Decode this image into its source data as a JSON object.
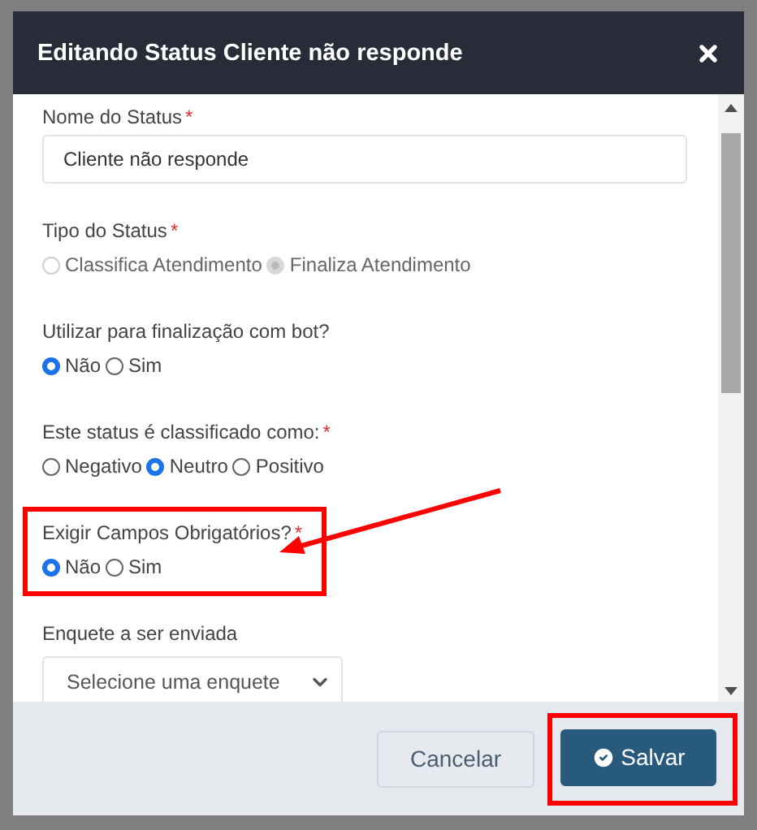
{
  "dialog": {
    "title": "Editando Status Cliente não responde"
  },
  "fields": [
    {
      "kind": "text",
      "label": "Nome do Status",
      "required_mark": "*",
      "highlighted": false,
      "value": "Cliente não responde"
    },
    {
      "kind": "radio",
      "label": "Tipo do Status",
      "required_mark": "*",
      "highlighted": false,
      "options": [
        {
          "label": "Classifica Atendimento",
          "selected": false,
          "disabled": true
        },
        {
          "label": "Finaliza Atendimento",
          "selected": true,
          "disabled": true
        }
      ]
    },
    {
      "kind": "radio",
      "label": "Utilizar para finalização com bot?",
      "highlighted": false,
      "options": [
        {
          "label": "Não",
          "selected": true,
          "disabled": false
        },
        {
          "label": "Sim",
          "selected": false,
          "disabled": false
        }
      ]
    },
    {
      "kind": "radio",
      "label": "Este status é classificado como:",
      "required_mark": "*",
      "highlighted": false,
      "options": [
        {
          "label": "Negativo",
          "selected": false,
          "disabled": false
        },
        {
          "label": "Neutro",
          "selected": true,
          "disabled": false
        },
        {
          "label": "Positivo",
          "selected": false,
          "disabled": false
        }
      ]
    },
    {
      "kind": "radio",
      "label": "Exigir Campos Obrigatórios?",
      "required_mark": "*",
      "highlighted": true,
      "options": [
        {
          "label": "Não",
          "selected": true,
          "disabled": false
        },
        {
          "label": "Sim",
          "selected": false,
          "disabled": false
        }
      ]
    },
    {
      "kind": "select",
      "label": "Enquete a ser enviada",
      "highlighted": false,
      "placeholder": "Selecione uma enquete"
    }
  ],
  "buttons": [
    {
      "kind": "secondary",
      "label": "Cancelar",
      "highlighted": false
    },
    {
      "kind": "primary",
      "label": "Salvar",
      "highlighted": true
    }
  ]
}
